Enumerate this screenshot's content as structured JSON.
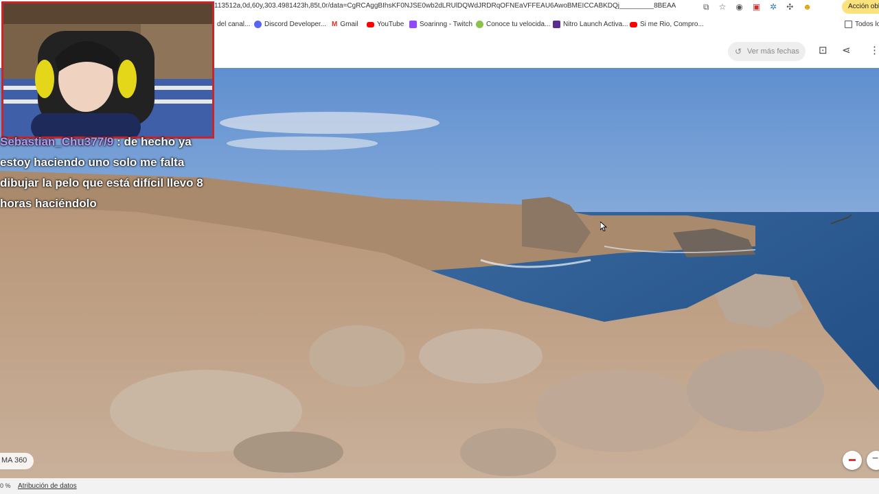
{
  "browser": {
    "url": "113512a,0d,60y,303.4981423h,85t,0r/data=CgRCAggBIhsKF0NJSE0wb2dLRUlDQWdJRDRqOFNEaVFFEAU6AwoBMEICCABKDQj_________8BEAA",
    "action_button": "Acción obli",
    "bookmarks": [
      {
        "label": "del canal...",
        "icon": "partial-icon",
        "color": "#888888"
      },
      {
        "label": "Discord Developer...",
        "icon": "discord-icon",
        "color": "#5865f2"
      },
      {
        "label": "Gmail",
        "icon": "gmail-icon",
        "color": "#d93025"
      },
      {
        "label": "YouTube",
        "icon": "youtube-icon",
        "color": "#ff0000"
      },
      {
        "label": "Soarinng - Twitch",
        "icon": "twitch-icon",
        "color": "#9146ff"
      },
      {
        "label": "Conoce tu velocida...",
        "icon": "speedtest-icon",
        "color": "#8bc34a"
      },
      {
        "label": "Nitro Launch Activa...",
        "icon": "nitro-icon",
        "color": "#5b2d90"
      },
      {
        "label": "Si me Rio, Compro...",
        "icon": "youtube-icon",
        "color": "#ff0000"
      },
      {
        "label": "Todos lo",
        "icon": "folder-icon",
        "color": "#555555"
      }
    ]
  },
  "maps": {
    "dates_button": "Ver más fechas",
    "panorama_label": "MA 360",
    "footer_left": "0 %",
    "attribution": "Atribución de datos"
  },
  "stream": {
    "chat_user": "Sebastian_Chu377/9",
    "chat_text": ": de hecho ya estoy haciendo uno solo me falta dibujar la pelo que está difícil llevo 8 horas haciéndolo"
  }
}
